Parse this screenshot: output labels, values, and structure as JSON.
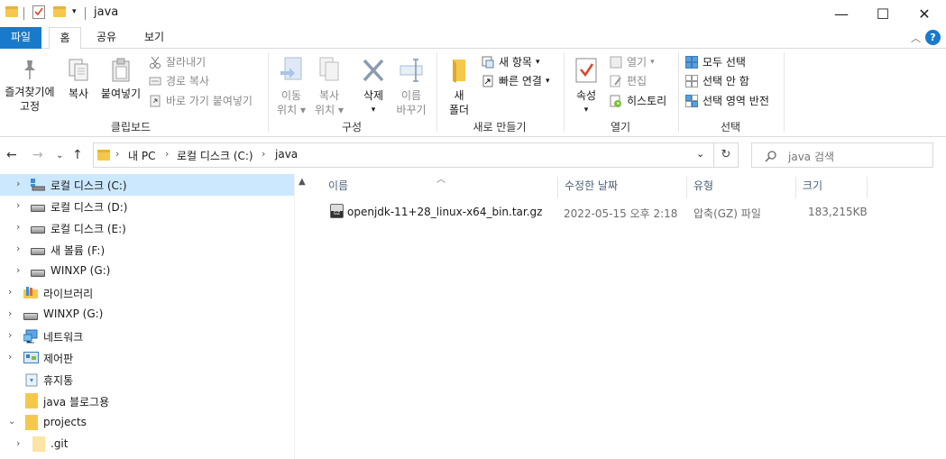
{
  "window": {
    "title": "java",
    "minimize": "—",
    "maximize": "☐",
    "close": "✕"
  },
  "ribbon_tabs": [
    "파일",
    "홈",
    "공유",
    "보기"
  ],
  "ribbon": {
    "clipboard": {
      "pin": [
        "즐겨찾기에",
        "고정"
      ],
      "copy": "복사",
      "paste": "붙여넣기",
      "cut": "잘라내기",
      "copy_path": "경로 복사",
      "paste_shortcut": "바로 가기 붙여넣기",
      "label": "클립보드"
    },
    "organize": {
      "move_to": [
        "이동",
        "위치"
      ],
      "copy_to": [
        "복사",
        "위치"
      ],
      "delete": "삭제",
      "rename": [
        "이름",
        "바꾸기"
      ],
      "label": "구성"
    },
    "new": {
      "new_folder": [
        "새",
        "폴더"
      ],
      "new_item": "새 항목",
      "easy_access": "빠른 연결",
      "label": "새로 만들기"
    },
    "open": {
      "properties": "속성",
      "open": "열기",
      "edit": "편집",
      "history": "히스토리",
      "label": "열기"
    },
    "select": {
      "select_all": "모두 선택",
      "select_none": "선택 안 함",
      "invert": "선택 영역 반전",
      "label": "선택"
    }
  },
  "address": {
    "crumbs": [
      "내 PC",
      "로컬 디스크 (C:)",
      "java"
    ],
    "search_placeholder": "java 검색"
  },
  "tree": [
    {
      "label": "로컬 디스크 (C:)",
      "type": "drive",
      "selected": true
    },
    {
      "label": "로컬 디스크 (D:)",
      "type": "drive"
    },
    {
      "label": "로컬 디스크 (E:)",
      "type": "drive"
    },
    {
      "label": "새 볼륨 (F:)",
      "type": "drive"
    },
    {
      "label": "WINXP (G:)",
      "type": "drive"
    },
    {
      "label": "라이브러리",
      "type": "library"
    },
    {
      "label": "WINXP (G:)",
      "type": "drive"
    },
    {
      "label": "네트워크",
      "type": "network"
    },
    {
      "label": "제어판",
      "type": "control-panel"
    },
    {
      "label": "휴지통",
      "type": "recycle-bin"
    },
    {
      "label": "java 블로그용",
      "type": "folder"
    },
    {
      "label": "projects",
      "type": "folder"
    },
    {
      "label": ".git",
      "type": "folder"
    }
  ],
  "columns": [
    "이름",
    "수정한 날짜",
    "유형",
    "크기"
  ],
  "files": [
    {
      "name": "openjdk-11+28_linux-x64_bin.tar.gz",
      "modified": "2022-05-15 오후 2:18",
      "type": "압축(GZ) 파일",
      "size": "183,215KB",
      "icon_badge": "GZ"
    }
  ],
  "colors": {
    "accent": "#1979ca",
    "selection": "#cce8ff",
    "folder": "#f5c84c"
  }
}
